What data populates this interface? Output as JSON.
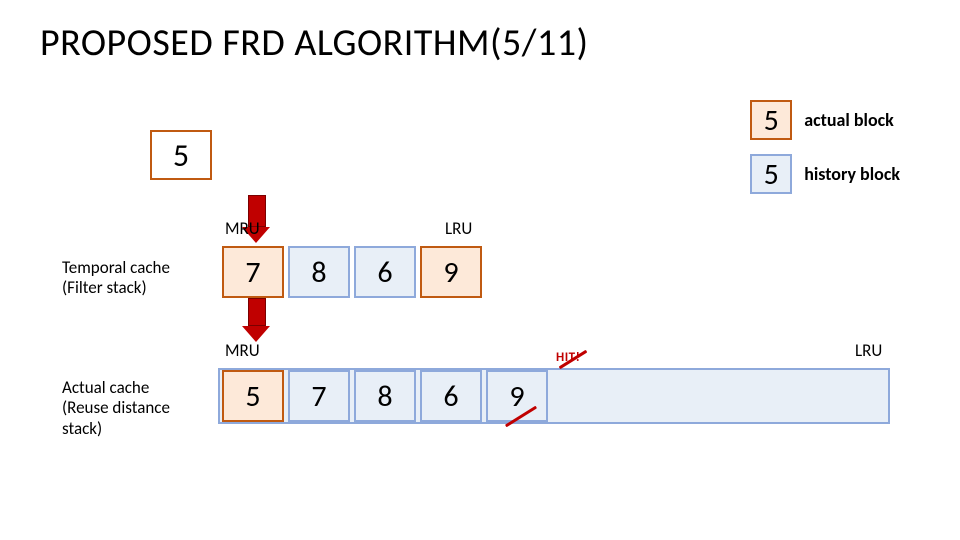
{
  "title": "PROPOSED FRD ALGORITHM(5/11)",
  "legend": {
    "actual": {
      "value": "5",
      "label": "actual block"
    },
    "history": {
      "value": "5",
      "label": "history block"
    }
  },
  "incoming_block": "5",
  "temporal": {
    "label_l1": "Temporal cache",
    "label_l2": "(Filter stack)",
    "left_tag": "MRU",
    "right_tag": "LRU",
    "cells": [
      "7",
      "8",
      "6",
      "9"
    ]
  },
  "actual_cache": {
    "label_l1": "Actual cache",
    "label_l2": "(Reuse distance",
    "label_l3": "stack)",
    "left_tag": "MRU",
    "right_tag": "LRU",
    "cells": [
      "5",
      "7",
      "8",
      "6",
      "9"
    ]
  },
  "hit_label": "HIT!"
}
